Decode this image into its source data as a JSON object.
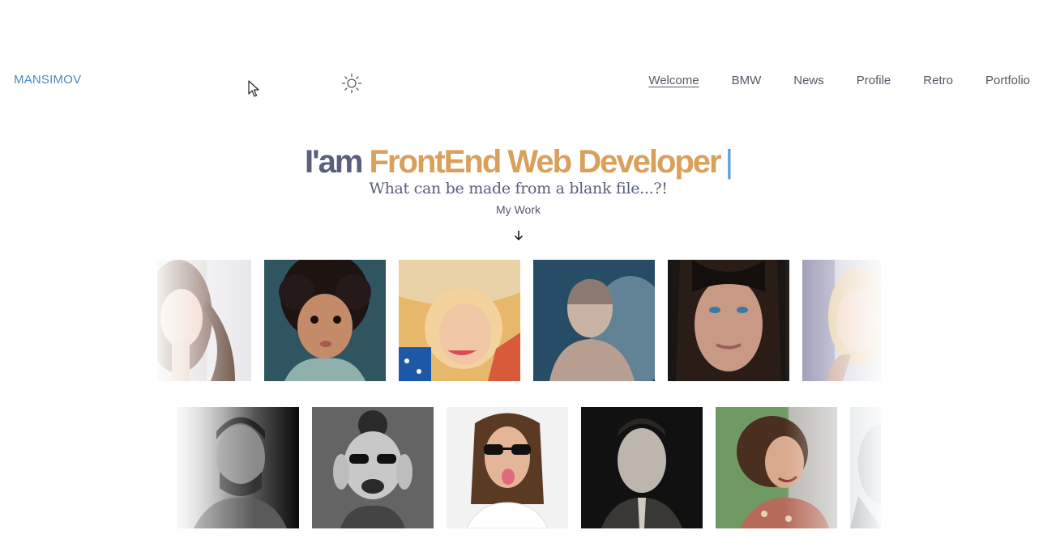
{
  "header": {
    "brand": "MANSIMOV",
    "theme_icon": "sun-icon",
    "nav": [
      {
        "label": "Welcome",
        "active": true
      },
      {
        "label": "BMW"
      },
      {
        "label": "News"
      },
      {
        "label": "Profile"
      },
      {
        "label": "Retro"
      },
      {
        "label": "Portfolio"
      }
    ]
  },
  "hero": {
    "prefix": "I'am",
    "role": "FrontEnd Web Developer",
    "caret": "|",
    "subtitle": "What can be made from a blank file...?!",
    "cta": "My Work",
    "cta_icon": "arrow-down-icon"
  },
  "colors": {
    "brand": "#4a87c0",
    "hero_prefix": "#5a5f7e",
    "hero_role": "#d9a05b",
    "caret": "#5aa0d8"
  },
  "gallery": {
    "row1": [
      {
        "label": "woman-portrait"
      },
      {
        "label": "curly-haired-child"
      },
      {
        "label": "woman-straw-hat"
      },
      {
        "label": "man-in-smoke"
      },
      {
        "label": "woman-blue-eyes"
      },
      {
        "label": "blonde-woman"
      }
    ],
    "row2": [
      {
        "label": "bearded-man-bw"
      },
      {
        "label": "laughing-woman-sunglasses"
      },
      {
        "label": "man-sunglasses-tongue"
      },
      {
        "label": "man-looking-up"
      },
      {
        "label": "curly-woman-smiling"
      },
      {
        "label": "partial-portrait"
      }
    ]
  }
}
